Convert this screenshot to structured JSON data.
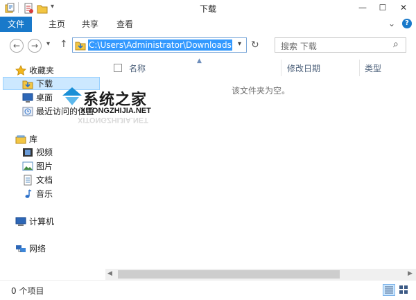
{
  "window": {
    "title": "下载",
    "minimize_label": "—",
    "maximize_label": "☐",
    "close_label": "✕"
  },
  "ribbon": {
    "tabs": [
      {
        "label": "文件"
      },
      {
        "label": "主页"
      },
      {
        "label": "共享"
      },
      {
        "label": "查看"
      }
    ],
    "expand_label": "⌄",
    "help_label": "?"
  },
  "navigation": {
    "back_label": "←",
    "forward_label": "→",
    "history_label": "▾",
    "up_label": "↑",
    "address_path": "C:\\Users\\Administrator\\Downloads",
    "address_dropdown": "▾",
    "refresh_label": "↻",
    "search_placeholder": "搜索 下载",
    "search_icon_glyph": "⌕"
  },
  "sidebar": {
    "favorites": {
      "label": "收藏夹"
    },
    "items": [
      {
        "label": "下载"
      },
      {
        "label": "桌面"
      },
      {
        "label": "最近访问的位置"
      }
    ],
    "libraries": {
      "label": "库"
    },
    "library_items": [
      {
        "label": "视频"
      },
      {
        "label": "图片"
      },
      {
        "label": "文档"
      },
      {
        "label": "音乐"
      }
    ],
    "computer": {
      "label": "计算机"
    },
    "network": {
      "label": "网络"
    }
  },
  "content": {
    "columns": [
      {
        "label": "名称"
      },
      {
        "label": "修改日期"
      },
      {
        "label": "类型"
      }
    ],
    "empty_message": "该文件夹为空。"
  },
  "status": {
    "item_count": "0 个项目"
  },
  "watermark": {
    "title": "系统之家",
    "subtitle": "XITONGZHIJIA.NET",
    "reflection": "XITONGZHIJIA.NET"
  },
  "colors": {
    "accent": "#1979ca",
    "selection": "#cce8ff",
    "address_highlight": "#3399ff"
  }
}
